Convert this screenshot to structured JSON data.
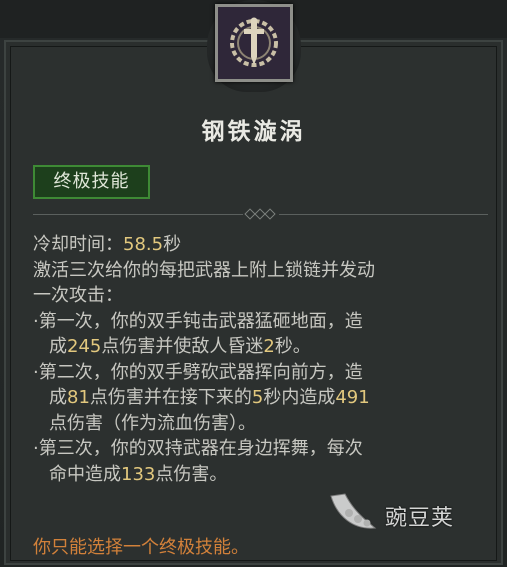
{
  "skill": {
    "name": "钢铁漩涡",
    "category": "终极技能",
    "icon": "chained-sword-icon"
  },
  "description": {
    "cooldown_label": "冷却时间：",
    "cooldown_value": "58.5",
    "cooldown_unit": "秒",
    "intro_line1": "激活三次给你的每把武器上附上锁链并发动",
    "intro_line2": "一次攻击：",
    "bullets": [
      {
        "line1": "第一次，你的双手钝击武器猛砸地面，造",
        "line2_pre": "成",
        "line2_num1": "245",
        "line2_mid": "点伤害并使敌人昏迷",
        "line2_num2": "2",
        "line2_post": "秒。"
      },
      {
        "line1": "第二次，你的双手劈砍武器挥向前方，造",
        "line2_pre": "成",
        "line2_num1": "81",
        "line2_mid": "点伤害并在接下来的",
        "line2_num2": "5",
        "line2_mid2": "秒内造成",
        "line2_num3": "491",
        "line3": "点伤害（作为流血伤害）。"
      },
      {
        "line1": "第三次，你的双持武器在身边挥舞，每次",
        "line2_pre": "命中造成",
        "line2_num1": "133",
        "line2_post": "点伤害。"
      }
    ],
    "bullet_symbol": "·"
  },
  "footer_note": "你只能选择一个终极技能。",
  "watermark": {
    "text": "豌豆荚",
    "icon": "wandoujia-logo-icon"
  },
  "colors": {
    "number_highlight": "#e2c87e",
    "footer": "#d2813a",
    "badge_border": "#3e8a35",
    "badge_bg": "#1d3f1c"
  }
}
